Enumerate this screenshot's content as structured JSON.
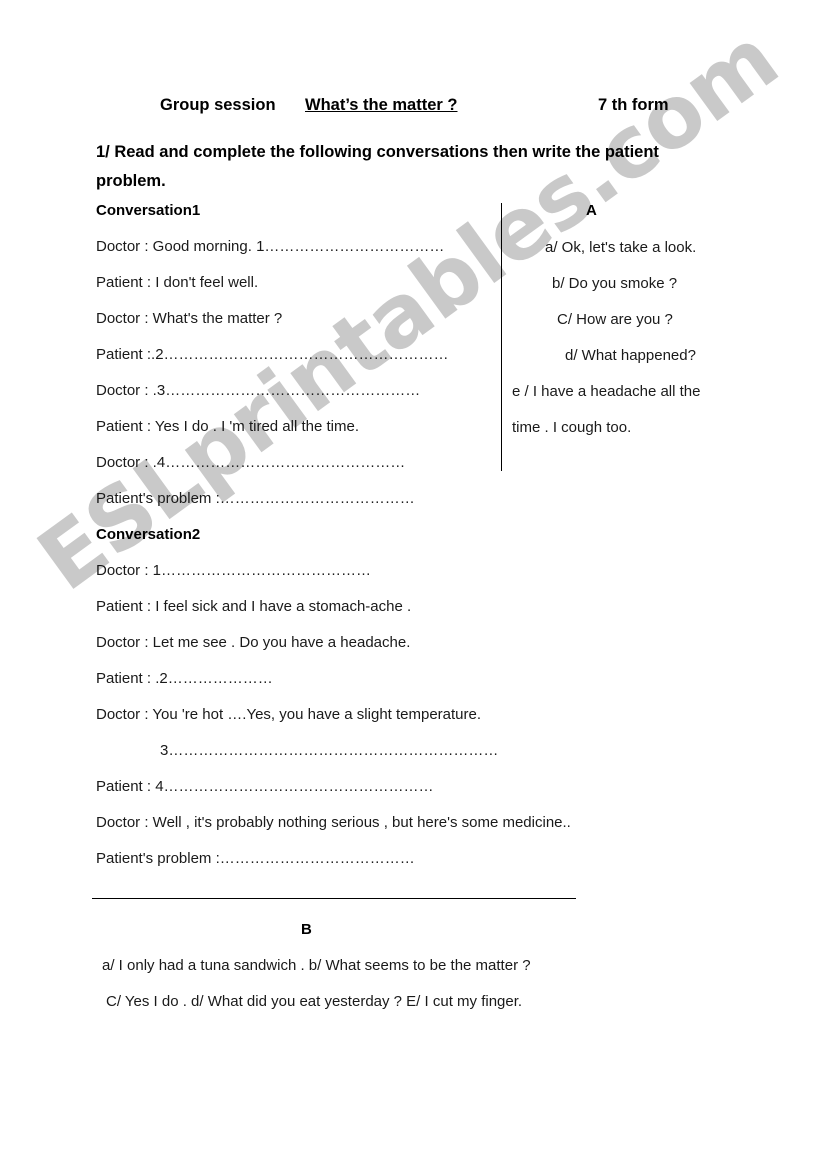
{
  "header": {
    "group_session": "Group session",
    "title": "What’s the matter ?",
    "form": "7 th form"
  },
  "instruction": "1/ Read and complete the following conversations then write the patient problem.",
  "conversation1": {
    "heading": "Conversation1",
    "lines": [
      "Doctor : Good morning. 1………………………………",
      "Patient : I don't feel well.",
      "Doctor : What's the matter ?",
      "Patient :.2…………………………………………………",
      "Doctor : .3……………………………………………",
      "Patient : Yes I do . I 'm tired all the time.",
      "Doctor : .4…………………………………………",
      "Patient's problem :…………………………………"
    ]
  },
  "conversation2": {
    "heading": "Conversation2",
    "lines": [
      "Doctor : 1……………………………………",
      "Patient : I feel sick and I have a stomach-ache .",
      "Doctor : Let me see . Do you have a headache.",
      "Patient : .2…………………",
      "Doctor : You 're hot ….Yes, you have a slight temperature.",
      "3…………………………………………………………",
      "Patient : 4………………………………………………",
      "Doctor : Well , it's probably nothing serious , but here's some medicine..",
      "Patient's problem :…………………………………"
    ]
  },
  "section_a": {
    "label": "A",
    "items": [
      "a/ Ok, let's take a look.",
      "b/ Do you smoke ?",
      "C/ How are you ?",
      "d/ What happened?",
      "e / I have a headache all the",
      "time . I cough too."
    ]
  },
  "section_b": {
    "label": "B",
    "lines": [
      "a/ I only had a tuna sandwich .   b/ What seems to be the matter ?",
      "C/ Yes I do . d/ What did you eat yesterday ? E/ I cut  my finger."
    ]
  },
  "watermark": {
    "text": "ESLprintables.com",
    "color": "#c9c9c9"
  }
}
